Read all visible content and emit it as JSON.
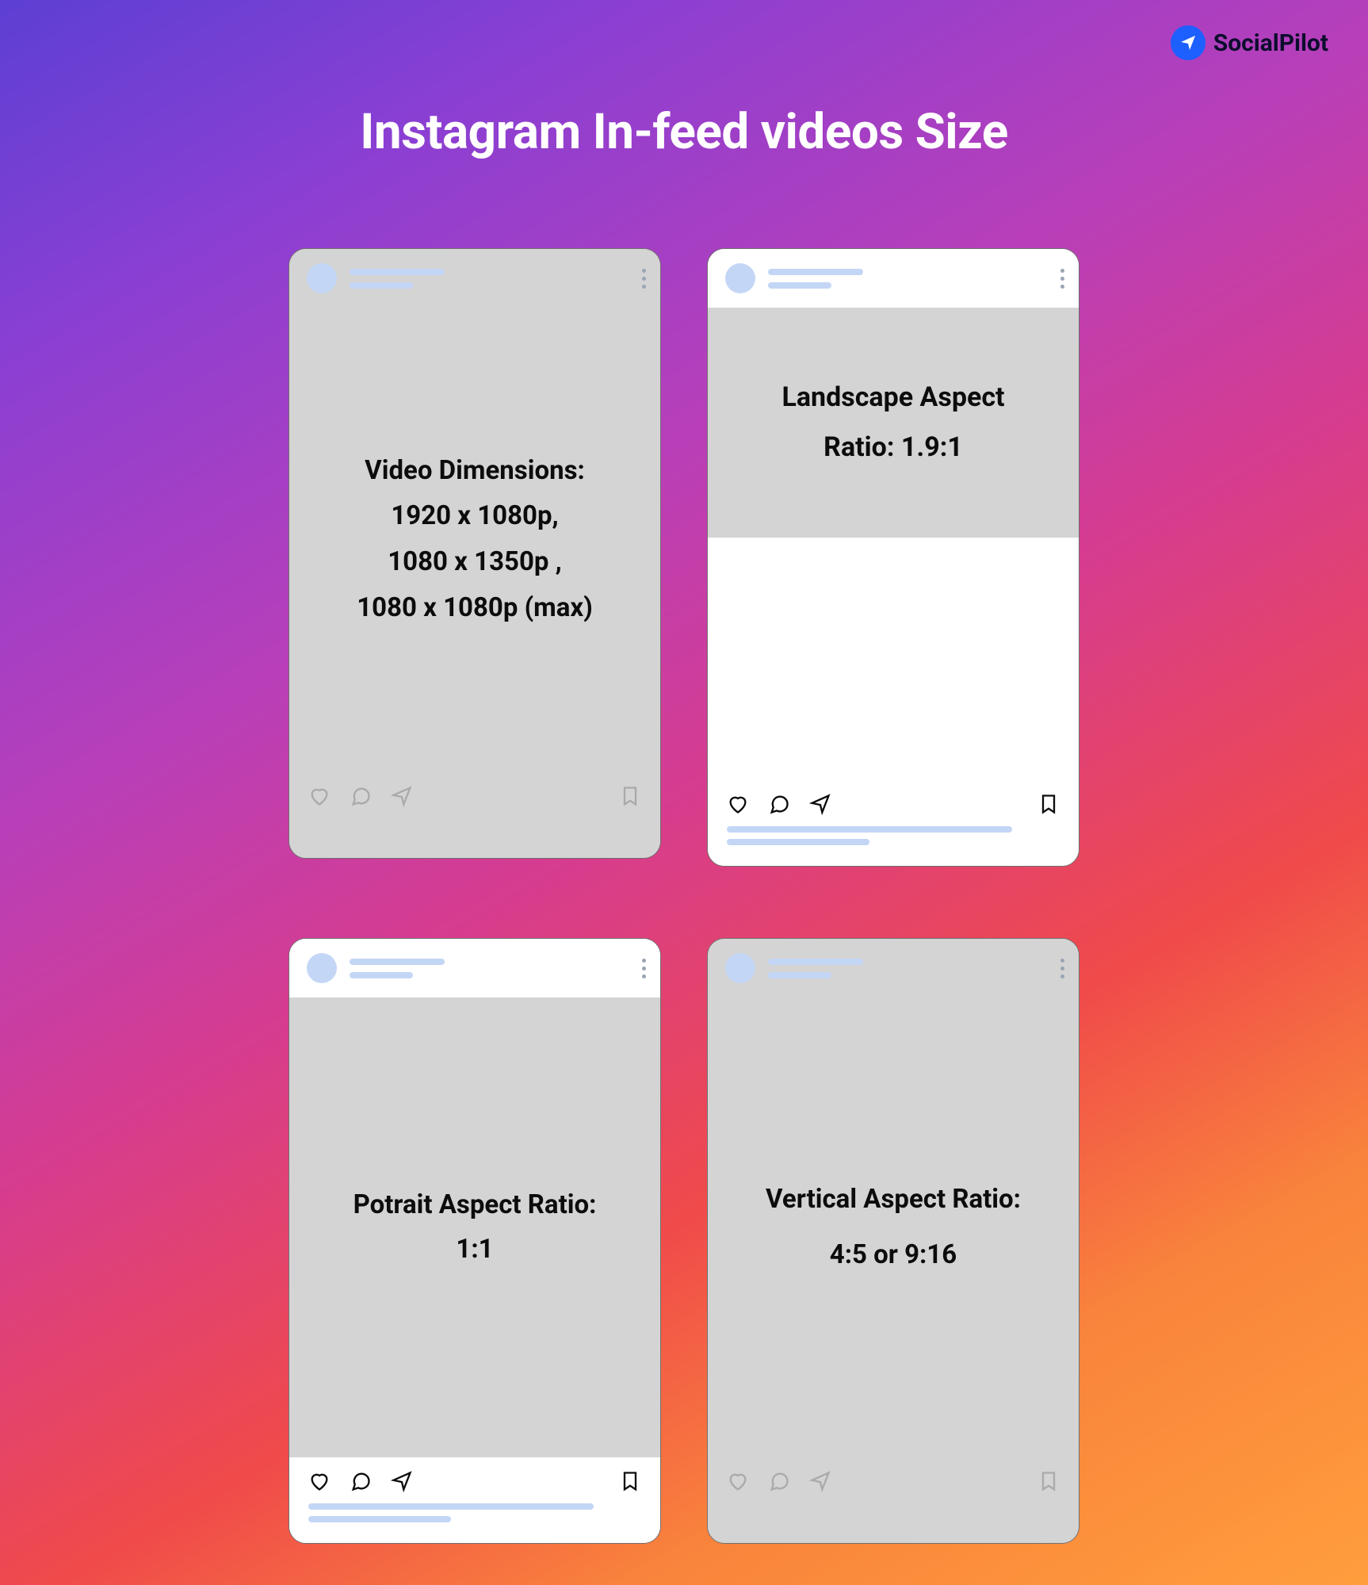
{
  "brand": {
    "name": "SocialPilot"
  },
  "title": "Instagram In-feed videos Size",
  "cards": {
    "dimensions": {
      "heading": "Video Dimensions:",
      "line1": "1920 x 1080p,",
      "line2": "1080 x 1350p ,",
      "line3": "1080 x 1080p (max)"
    },
    "landscape": {
      "line1": "Landscape Aspect",
      "line2": "Ratio: 1.9:1"
    },
    "portrait": {
      "line1": "Potrait Aspect Ratio:",
      "line2": "1:1"
    },
    "vertical": {
      "line1": "Vertical Aspect Ratio:",
      "line2": "4:5 or 9:16"
    }
  }
}
